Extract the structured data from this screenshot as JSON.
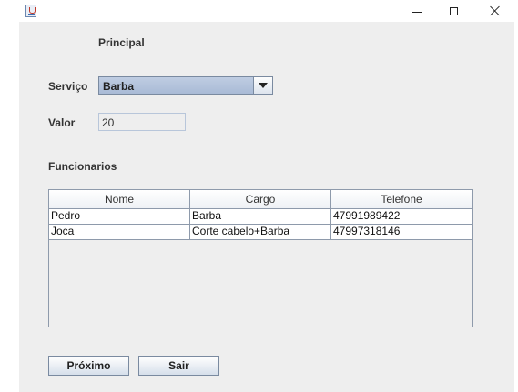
{
  "window": {
    "title": ""
  },
  "form": {
    "heading": "Principal",
    "servico_label": "Serviço",
    "servico_value": "Barba",
    "valor_label": "Valor",
    "valor_value": "20",
    "funcionarios_label": "Funcionarios"
  },
  "table": {
    "columns": [
      "Nome",
      "Cargo",
      "Telefone"
    ],
    "rows": [
      [
        "Pedro",
        "Barba",
        "47991989422"
      ],
      [
        "Joca",
        "Corte cabelo+Barba",
        "47997318146"
      ]
    ]
  },
  "buttons": {
    "next": "Próximo",
    "exit": "Sair"
  },
  "icons": {
    "app": "java-cup-icon",
    "minimize": "minimize-icon",
    "maximize": "maximize-icon",
    "close": "close-icon",
    "dropdown": "chevron-down-icon"
  }
}
